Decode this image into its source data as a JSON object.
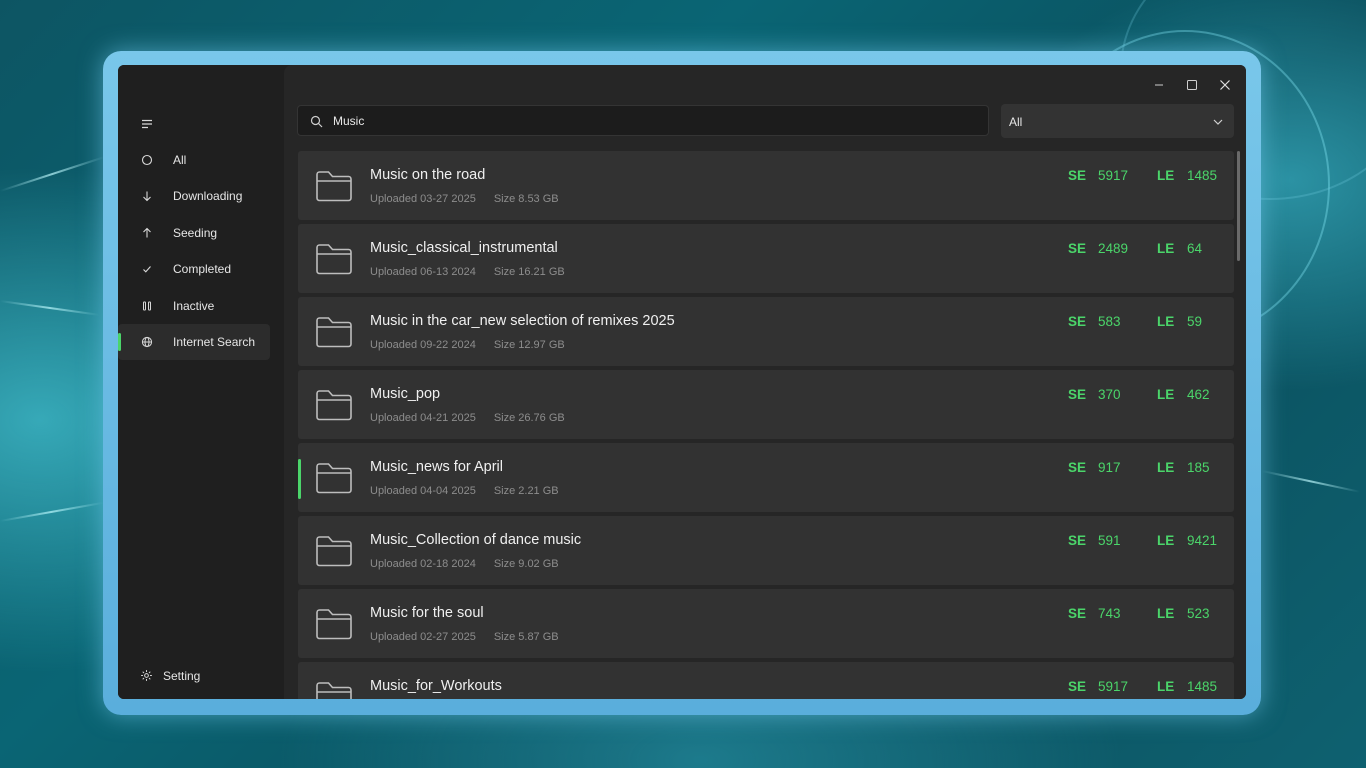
{
  "colors": {
    "accent": "#4bd56a",
    "window_bg": "#1f1f1f",
    "content_bg": "#262626",
    "row_bg": "#323232",
    "frame": "#6ab9e2"
  },
  "window_controls": {
    "minimize_icon": "minimize-icon",
    "maximize_icon": "maximize-icon",
    "close_icon": "close-icon"
  },
  "sidebar": {
    "menu_icon": "hamburger-menu-icon",
    "items": [
      {
        "label": "All",
        "icon": "circle-icon"
      },
      {
        "label": "Downloading",
        "icon": "arrow-down-icon"
      },
      {
        "label": "Seeding",
        "icon": "arrow-up-icon"
      },
      {
        "label": "Completed",
        "icon": "checkmark-icon"
      },
      {
        "label": "Inactive",
        "icon": "pause-icon"
      },
      {
        "label": "Internet Search",
        "icon": "globe-icon",
        "active": true
      }
    ],
    "setting": {
      "label": "Setting",
      "icon": "gear-icon"
    }
  },
  "search": {
    "value": "Music",
    "icon": "search-icon"
  },
  "filter": {
    "selected": "All"
  },
  "results": [
    {
      "title": "Music on the road",
      "uploaded": "Uploaded 03-27 2025",
      "size": "Size 8.53 GB",
      "se_label": "SE",
      "se": "5917",
      "le_label": "LE",
      "le": "1485"
    },
    {
      "title": "Music_classical_instrumental",
      "uploaded": "Uploaded 06-13 2024",
      "size": "Size 16.21 GB",
      "se_label": "SE",
      "se": "2489",
      "le_label": "LE",
      "le": "64"
    },
    {
      "title": "Music in the car_new selection of remixes 2025",
      "uploaded": "Uploaded 09-22 2024",
      "size": "Size 12.97 GB",
      "se_label": "SE",
      "se": "583",
      "le_label": "LE",
      "le": "59"
    },
    {
      "title": "Music_pop",
      "uploaded": "Uploaded 04-21 2025",
      "size": "Size 26.76 GB",
      "se_label": "SE",
      "se": "370",
      "le_label": "LE",
      "le": "462"
    },
    {
      "title": "Music_news for April",
      "uploaded": "Uploaded 04-04 2025",
      "size": "Size 2.21 GB",
      "se_label": "SE",
      "se": "917",
      "le_label": "LE",
      "le": "185",
      "selected": true
    },
    {
      "title": "Music_Collection of dance music",
      "uploaded": "Uploaded 02-18 2024",
      "size": "Size 9.02 GB",
      "se_label": "SE",
      "se": "591",
      "le_label": "LE",
      "le": "9421"
    },
    {
      "title": "Music for the soul",
      "uploaded": "Uploaded 02-27 2025",
      "size": "Size 5.87 GB",
      "se_label": "SE",
      "se": "743",
      "le_label": "LE",
      "le": "523"
    },
    {
      "title": "Music_for_Workouts",
      "uploaded": "",
      "size": "",
      "se_label": "SE",
      "se": "5917",
      "le_label": "LE",
      "le": "1485"
    }
  ]
}
